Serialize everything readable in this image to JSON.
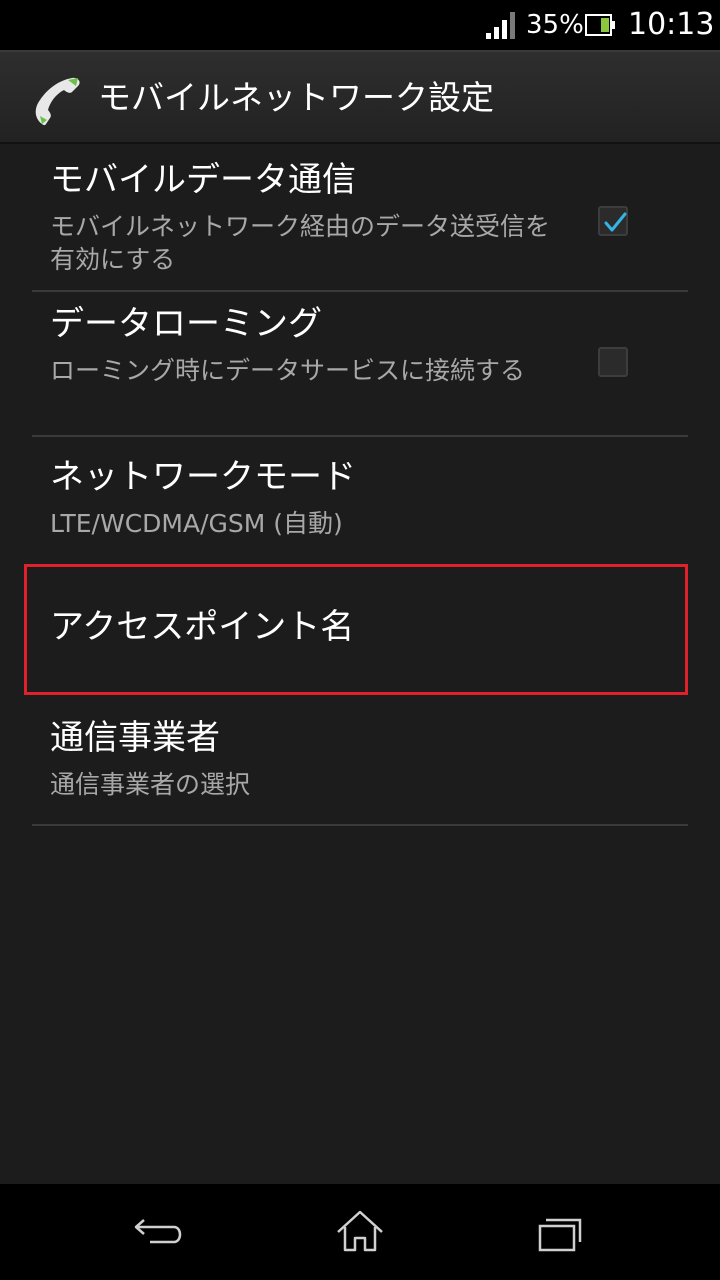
{
  "status_bar": {
    "battery_percent": "35%",
    "time": "10:13",
    "icons": [
      "signal-icon",
      "battery-icon"
    ]
  },
  "action_bar": {
    "title": "モバイルネットワーク設定",
    "icon": "phone-icon"
  },
  "preferences": [
    {
      "title": "モバイルデータ通信",
      "summary": "モバイルネットワーク経由のデータ送受信を有効にする",
      "checked": true
    },
    {
      "title": "データローミング",
      "summary": "ローミング時にデータサービスに接続する",
      "checked": false
    },
    {
      "title": "ネットワークモード",
      "summary": "LTE/WCDMA/GSM (自動)"
    },
    {
      "title": "アクセスポイント名",
      "highlighted": true
    },
    {
      "title": "通信事業者",
      "summary": "通信事業者の選択"
    }
  ],
  "nav_bar": {
    "icons": [
      "back-icon",
      "home-icon",
      "recent-apps-icon"
    ]
  },
  "colors": {
    "highlight": "#e0202a",
    "check_accent": "#33b5e5",
    "phone_accent": "#6cc04a"
  }
}
